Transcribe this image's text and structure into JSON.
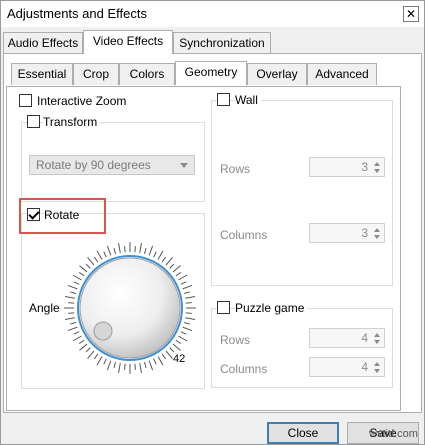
{
  "window": {
    "title": "Adjustments and Effects",
    "close_glyph": "✕"
  },
  "main_tabs": [
    {
      "label": "Audio Effects"
    },
    {
      "label": "Video Effects"
    },
    {
      "label": "Synchronization"
    }
  ],
  "sub_tabs": [
    {
      "label": "Essential"
    },
    {
      "label": "Crop"
    },
    {
      "label": "Colors"
    },
    {
      "label": "Geometry"
    },
    {
      "label": "Overlay"
    },
    {
      "label": "Advanced"
    }
  ],
  "geometry": {
    "interactive_zoom": {
      "label": "Interactive Zoom",
      "checked": false
    },
    "transform": {
      "label": "Transform",
      "checked": false,
      "select_value": "Rotate by 90 degrees"
    },
    "rotate": {
      "label": "Rotate",
      "checked": true,
      "angle_label": "Angle",
      "angle_value": "42"
    }
  },
  "wall": {
    "label": "Wall",
    "checked": false,
    "rows_label": "Rows",
    "rows_value": "3",
    "columns_label": "Columns",
    "columns_value": "3"
  },
  "puzzle": {
    "label": "Puzzle game",
    "checked": false,
    "rows_label": "Rows",
    "rows_value": "4",
    "columns_label": "Columns",
    "columns_value": "4"
  },
  "buttons": {
    "close": "Close",
    "save": "Save"
  },
  "watermark": "wvtid.com",
  "colors": {
    "highlight": "#d9534f",
    "dial_accent": "#3c8fd6"
  }
}
